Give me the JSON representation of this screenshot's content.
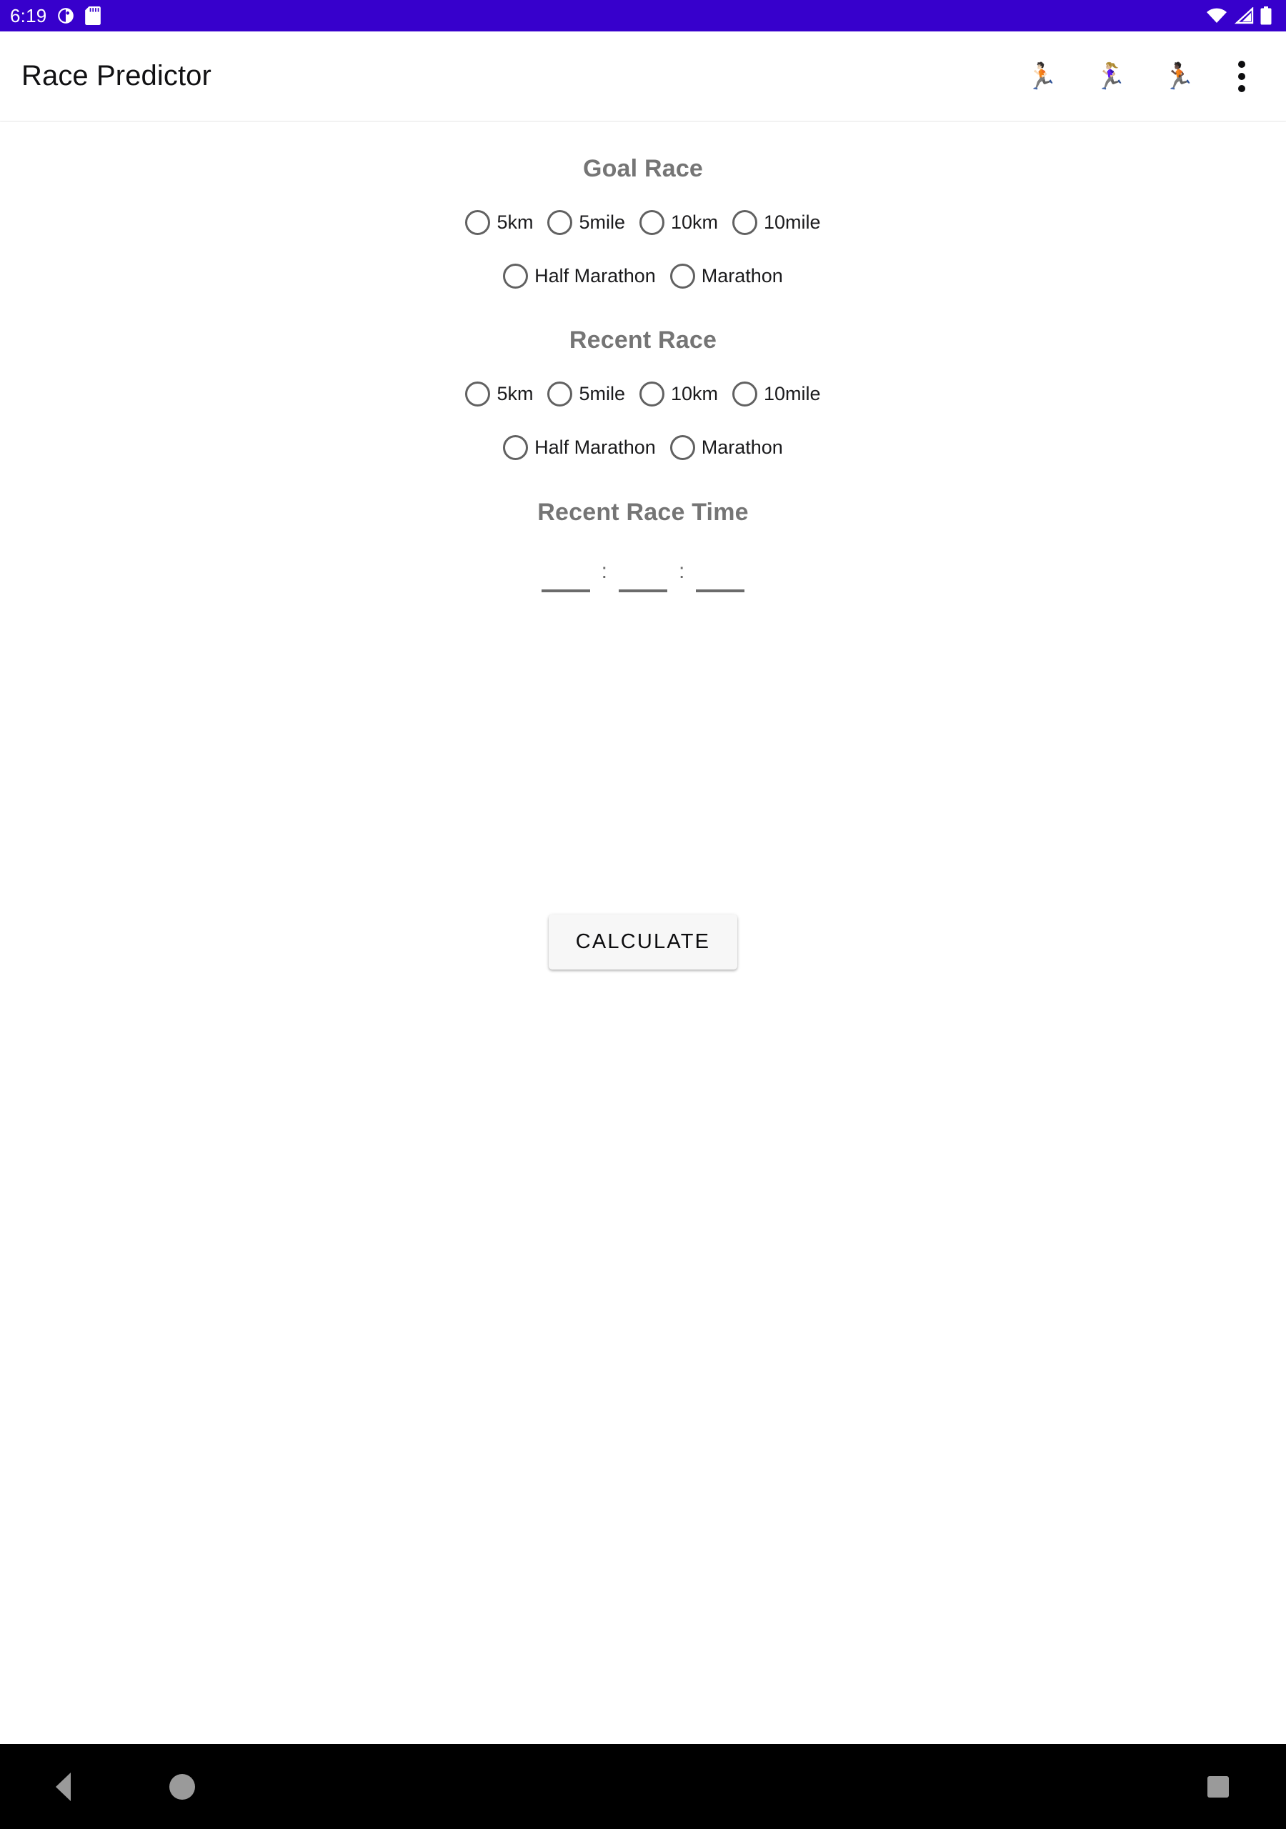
{
  "status_bar": {
    "time": "6:19",
    "background_color": "#3700CC",
    "left_icons": [
      {
        "name": "app-notification-icon",
        "glyph": "◕"
      },
      {
        "name": "sd-card-icon",
        "glyph": "▤"
      }
    ],
    "right_icons": [
      {
        "name": "wifi-icon"
      },
      {
        "name": "cell-signal-icon"
      },
      {
        "name": "battery-icon"
      }
    ]
  },
  "app_bar": {
    "title": "Race Predictor",
    "actions": [
      {
        "name": "runner-man-light-icon",
        "glyph": "🏃🏻"
      },
      {
        "name": "runner-woman-icon",
        "glyph": "🏃🏼‍♀️"
      },
      {
        "name": "runner-man-dark-icon",
        "glyph": "🏃🏿"
      }
    ],
    "overflow_label": "More options"
  },
  "main": {
    "goal_race": {
      "title": "Goal Race",
      "row1": [
        "5km",
        "5mile",
        "10km",
        "10mile"
      ],
      "row2": [
        "Half Marathon",
        "Marathon"
      ],
      "selected": null
    },
    "recent_race": {
      "title": "Recent Race",
      "row1": [
        "5km",
        "5mile",
        "10km",
        "10mile"
      ],
      "row2": [
        "Half Marathon",
        "Marathon"
      ],
      "selected": null
    },
    "recent_race_time": {
      "title": "Recent Race Time",
      "hours": "",
      "minutes": "",
      "seconds": "",
      "separator": ":"
    },
    "calculate_button": "CALCULATE"
  },
  "nav_bar": {
    "back": "Back",
    "home": "Home",
    "recents": "Recent apps",
    "background_color": "#000000"
  },
  "colors": {
    "status_bar": "#3700CC",
    "section_heading": "#757575",
    "radio_ring": "#616161",
    "button_bg": "#f7f7f7"
  }
}
